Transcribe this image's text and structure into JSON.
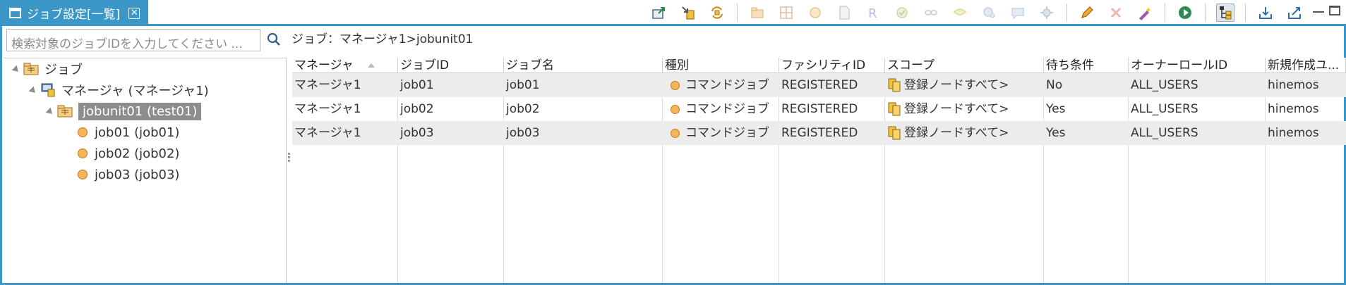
{
  "tab": {
    "title": "ジョブ設定[一覧]",
    "close_icon": "close-icon"
  },
  "toolbar": {
    "buttons": [
      "export-icon",
      "import-icon",
      "sync-icon",
      "jobunit-icon",
      "jobnet-icon",
      "job-icon",
      "file-job-icon",
      "reference-job-icon",
      "approval-job-icon",
      "monitor-job-icon",
      "filecheck-job-icon",
      "rpa-job-icon",
      "resource-job-icon",
      "jobnet-ref-icon",
      "edit-icon",
      "delete-icon",
      "clear-icon",
      "run-icon",
      "tree-view-icon",
      "import-wizard-icon",
      "export-wizard-icon"
    ]
  },
  "window_controls": {
    "minimize": "minimize-icon",
    "maximize": "maximize-icon"
  },
  "search": {
    "placeholder": "検索対象のジョブIDを入力してください ..."
  },
  "breadcrumb": "ジョブ：マネージャ1>jobunit01",
  "tree": {
    "root": {
      "label": "ジョブ",
      "icon": "folder-icon"
    },
    "manager": {
      "label": "マネージャ (マネージャ1)",
      "icon": "manager-icon"
    },
    "jobunit": {
      "label": "jobunit01 (test01)",
      "icon": "jobunit-icon"
    },
    "jobs": [
      {
        "label": "job01 (job01)"
      },
      {
        "label": "job02 (job02)"
      },
      {
        "label": "job03 (job03)"
      }
    ]
  },
  "table": {
    "columns": [
      "マネージャ",
      "ジョブID",
      "ジョブ名",
      "種別",
      "ファシリティID",
      "スコープ",
      "待ち条件",
      "オーナーロールID",
      "新規作成ユ..."
    ],
    "rows": [
      {
        "manager": "マネージャ1",
        "job_id": "job01",
        "job_name": "job01",
        "type": "コマンドジョブ",
        "facility_id": "REGISTERED",
        "scope": "登録ノードすべて>",
        "wait": "No",
        "owner_role": "ALL_USERS",
        "creator": "hinemos"
      },
      {
        "manager": "マネージャ1",
        "job_id": "job02",
        "job_name": "job02",
        "type": "コマンドジョブ",
        "facility_id": "REGISTERED",
        "scope": "登録ノードすべて>",
        "wait": "Yes",
        "owner_role": "ALL_USERS",
        "creator": "hinemos"
      },
      {
        "manager": "マネージャ1",
        "job_id": "job03",
        "job_name": "job03",
        "type": "コマンドジョブ",
        "facility_id": "REGISTERED",
        "scope": "登録ノードすべて>",
        "wait": "Yes",
        "owner_role": "ALL_USERS",
        "creator": "hinemos"
      }
    ]
  },
  "colors": {
    "accent": "#3c97c9",
    "row_alt": "#ececec",
    "selection": "#8d8d8d",
    "job_dot": "#f5b35a"
  }
}
